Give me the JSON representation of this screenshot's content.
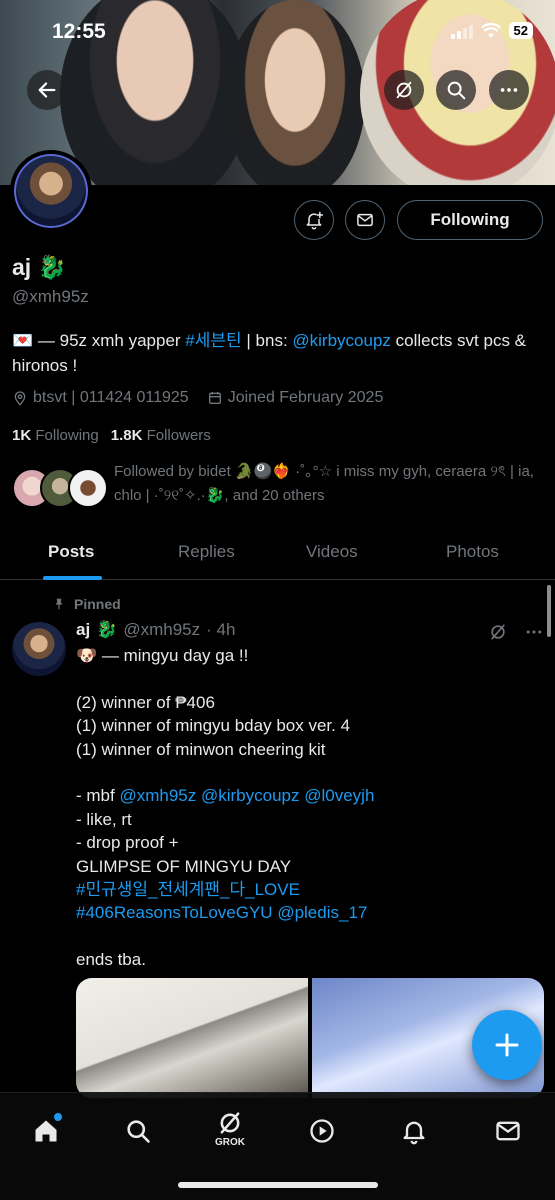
{
  "status_bar": {
    "time": "12:55",
    "battery": "52"
  },
  "profile": {
    "name": "aj",
    "name_emoji": "🐉",
    "handle": "@xmh95z",
    "bio": {
      "emoji": "💌",
      "text1": " — 95z xmh yapper ",
      "hashtag": "#세븐틴",
      "text2": " | bns: ",
      "mention": "@kirbycoupz",
      "text3": " collects svt pcs & hironos !"
    },
    "location": "btsvt | 011424 011925",
    "joined": "Joined February 2025",
    "following_count": "1K",
    "following_label": "Following",
    "followers_count": "1.8K",
    "followers_label": "Followers",
    "followed_by": "Followed by bidet 🐊🎱❤️‍🔥 ·˚｡°☆ i miss my gyh, ceraera ୨ৎ | ia, chlo | ·˚୨୧˚✧.·🐉, and 20 others"
  },
  "header_buttons": {
    "following": "Following"
  },
  "tabs": [
    {
      "label": "Posts"
    },
    {
      "label": "Replies"
    },
    {
      "label": "Videos"
    },
    {
      "label": "Photos"
    }
  ],
  "post": {
    "pinned_label": "Pinned",
    "name": "aj",
    "name_emoji": "🐉",
    "handle": "@xmh95z",
    "time": "· 4h",
    "lines": [
      {
        "parts": [
          {
            "t": "🐶 — mingyu day ga !!"
          }
        ]
      },
      {
        "parts": []
      },
      {
        "parts": [
          {
            "t": "(2) winner of ₱406"
          }
        ]
      },
      {
        "parts": [
          {
            "t": "(1) winner of mingyu bday box ver. 4"
          }
        ]
      },
      {
        "parts": [
          {
            "t": "(1) winner of minwon cheering kit"
          }
        ]
      },
      {
        "parts": []
      },
      {
        "parts": [
          {
            "t": "- mbf "
          },
          {
            "t": "@xmh95z",
            "link": true
          },
          {
            "t": " "
          },
          {
            "t": "@kirbycoupz",
            "link": true
          },
          {
            "t": " "
          },
          {
            "t": "@l0veyjh",
            "link": true
          }
        ]
      },
      {
        "parts": [
          {
            "t": "- like, rt"
          }
        ]
      },
      {
        "parts": [
          {
            "t": "- drop proof +"
          }
        ]
      },
      {
        "parts": [
          {
            "t": "GLIMPSE OF MINGYU DAY"
          }
        ]
      },
      {
        "parts": [
          {
            "t": "#민규생일_전세계팬_다_LOVE",
            "link": true
          }
        ]
      },
      {
        "parts": [
          {
            "t": "#406ReasonsToLoveGYU",
            "link": true
          },
          {
            "t": " "
          },
          {
            "t": "@pledis_17",
            "link": true
          }
        ]
      },
      {
        "parts": []
      },
      {
        "parts": [
          {
            "t": "ends tba."
          }
        ]
      }
    ]
  },
  "nav": {
    "grok_label": "GROK"
  },
  "colors": {
    "accent": "#1d9bf0",
    "muted": "#71767b",
    "text": "#e7e9ea",
    "background": "#000000"
  }
}
